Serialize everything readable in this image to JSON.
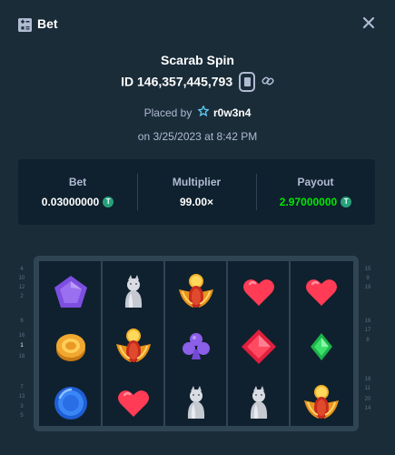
{
  "header": {
    "title": "Bet",
    "icon": "bet-icon",
    "close_icon": "close-icon"
  },
  "details": {
    "game_name": "Scarab Spin",
    "bet_id": "ID 146,357,445,793",
    "placed_by_prefix": "Placed by",
    "username": "r0w3n4",
    "date": "on 3/25/2023 at 8:42 PM"
  },
  "stats": {
    "bet_label": "Bet",
    "bet_value": "0.03000000",
    "multiplier_label": "Multiplier",
    "multiplier_value": "99.00×",
    "payout_label": "Payout",
    "payout_value": "2.97000000",
    "currency_icon": "tether-icon",
    "payout_color": "#00e701"
  },
  "paylines": {
    "left": [
      "4",
      "10",
      "12",
      "2",
      "6",
      "16",
      "1",
      "18",
      "7",
      "13",
      "3",
      "5"
    ],
    "right": [
      "15",
      "9",
      "19",
      "16",
      "17",
      "8",
      "18",
      "11",
      "20",
      "14"
    ]
  },
  "grid": [
    [
      "purple-pentagon-gem",
      "silver-cat-statue",
      "golden-scarab",
      "red-heart",
      "red-heart"
    ],
    [
      "gold-coin",
      "golden-scarab",
      "purple-club",
      "red-diamond-gem",
      "green-diamond-gem"
    ],
    [
      "blue-ring",
      "red-heart",
      "silver-cat-statue",
      "silver-cat-statue",
      "golden-scarab"
    ]
  ],
  "colors": {
    "background": "#1a2c38",
    "panel": "#0f212e",
    "accent_green": "#00e701",
    "muted": "#b1bad3"
  }
}
